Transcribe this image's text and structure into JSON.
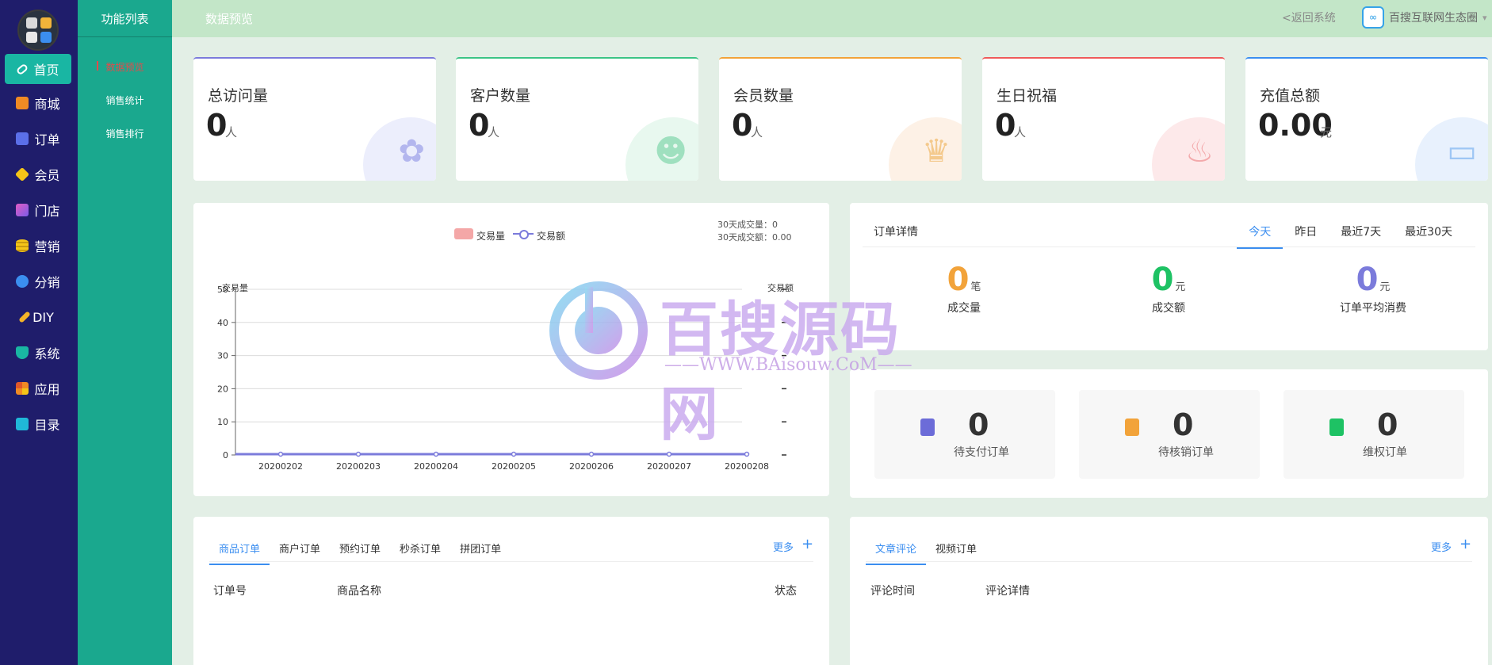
{
  "sidebar": {
    "items": [
      {
        "label": "首页",
        "icon": "link-icon",
        "active": true
      },
      {
        "label": "商城",
        "icon": "shop-icon"
      },
      {
        "label": "订单",
        "icon": "bag-icon"
      },
      {
        "label": "会员",
        "icon": "gem-icon"
      },
      {
        "label": "门店",
        "icon": "store-icon"
      },
      {
        "label": "营销",
        "icon": "coins-icon"
      },
      {
        "label": "分销",
        "icon": "globe-icon"
      },
      {
        "label": "DIY",
        "icon": "wrench-icon"
      },
      {
        "label": "系统",
        "icon": "shield-icon"
      },
      {
        "label": "应用",
        "icon": "apps-icon"
      },
      {
        "label": "目录",
        "icon": "folder-icon"
      }
    ]
  },
  "submenu": {
    "title": "功能列表",
    "items": [
      "数据预览",
      "销售统计",
      "销售排行"
    ]
  },
  "topbar": {
    "title": "数据预览",
    "back_label": "<返回系统",
    "brand": "百搜互联网生态圈"
  },
  "stats": [
    {
      "label": "总访问量",
      "value": "0",
      "unit": "人",
      "icon": "paw-icon",
      "accent": "#7b7bdb"
    },
    {
      "label": "客户数量",
      "value": "0",
      "unit": "人",
      "icon": "users-icon",
      "accent": "#3cc486"
    },
    {
      "label": "会员数量",
      "value": "0",
      "unit": "人",
      "icon": "crown-icon",
      "accent": "#f2a33a"
    },
    {
      "label": "生日祝福",
      "value": "0",
      "unit": "人",
      "icon": "cake-icon",
      "accent": "#ef5a5a"
    },
    {
      "label": "充值总额",
      "value": "0.00",
      "unit": "元",
      "icon": "card-icon",
      "accent": "#3b8ef0"
    }
  ],
  "chart_summary": {
    "line1": "30天成交量：0",
    "line2": "30天成交额：0.00"
  },
  "chart_data": {
    "type": "bar",
    "categories": [
      "20200202",
      "20200203",
      "20200204",
      "20200205",
      "20200206",
      "20200207",
      "20200208"
    ],
    "series": [
      {
        "name": "交易量",
        "type": "bar",
        "values": [
          0,
          0,
          0,
          0,
          0,
          0,
          0
        ],
        "color": "#f4a7a7"
      },
      {
        "name": "交易额",
        "type": "line",
        "values": [
          0,
          0,
          0,
          0,
          0,
          0,
          0
        ],
        "color": "#7b7bdb"
      }
    ],
    "ylabel": "交易量",
    "y2label": "交易额",
    "ylim": [
      0,
      50
    ],
    "yticks": [
      0,
      10,
      20,
      30,
      40,
      50
    ],
    "grid": true,
    "legend": "top-center"
  },
  "order_details": {
    "title": "订单详情",
    "tabs": [
      "今天",
      "昨日",
      "最近7天",
      "最近30天"
    ],
    "metrics": [
      {
        "value": "0",
        "unit": "笔",
        "label": "成交量",
        "color": "#f2a33a"
      },
      {
        "value": "0",
        "unit": "元",
        "label": "成交额",
        "color": "#1ec264"
      },
      {
        "value": "0",
        "unit": "元",
        "label": "订单平均消费",
        "color": "#7b7bdb"
      }
    ]
  },
  "pending": [
    {
      "value": "0",
      "label": "待支付订单",
      "icon": "clipboard-icon",
      "color": "#6c6cd8"
    },
    {
      "value": "0",
      "label": "待核销订单",
      "icon": "doc-clock-icon",
      "color": "#f2a33a"
    },
    {
      "value": "0",
      "label": "维权订单",
      "icon": "doc-gear-icon",
      "color": "#1ec264"
    }
  ],
  "orders_panel": {
    "tabs": [
      "商品订单",
      "商户订单",
      "预约订单",
      "秒杀订单",
      "拼团订单"
    ],
    "more": "更多",
    "plus": "+",
    "columns": [
      "订单号",
      "商品名称",
      "状态"
    ]
  },
  "comments_panel": {
    "tabs": [
      "文章评论",
      "视频订单"
    ],
    "more": "更多",
    "plus": "+",
    "columns": [
      "评论时间",
      "评论详情"
    ]
  },
  "watermark": {
    "text": "百搜源码网",
    "url": "——WWW.BAisouw.CoM——"
  }
}
